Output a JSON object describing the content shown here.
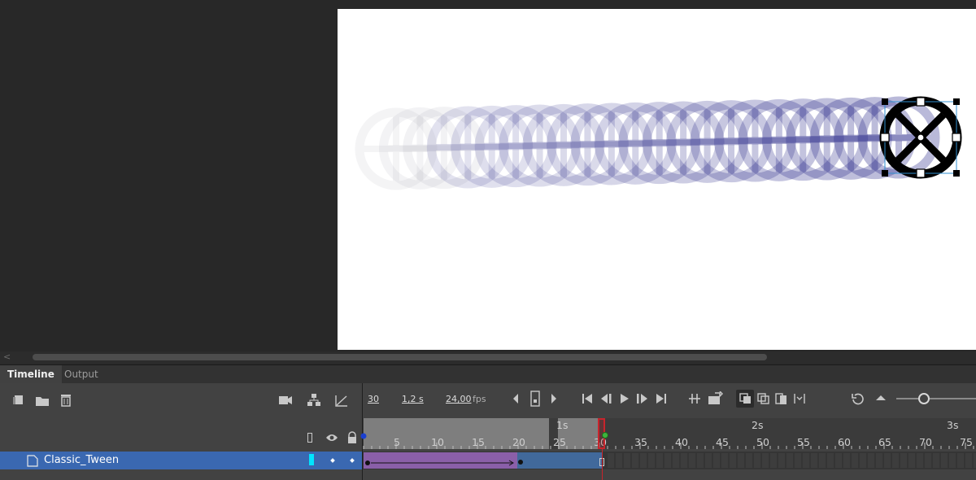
{
  "stage": {
    "background": "#ffffff",
    "symbol_color": "#1a1a80"
  },
  "panel": {
    "tabs": [
      {
        "label": "Timeline"
      },
      {
        "label": "Output"
      }
    ]
  },
  "controls": {
    "current_frame": "30",
    "time": "1,2 s",
    "fps_value": "24,00",
    "fps_unit": "fps"
  },
  "ruler": {
    "frame_numbers": [
      "5",
      "10",
      "15",
      "20",
      "25",
      "30",
      "35",
      "40",
      "45",
      "50",
      "55",
      "60",
      "65",
      "70",
      "75"
    ],
    "seconds": [
      "1s",
      "2s",
      "3s"
    ]
  },
  "layer": {
    "name": "Classic_Tween",
    "color": "#00e5ff"
  },
  "colors": {
    "tween_purple": "#8a5fa8",
    "tween_blue": "#41699b",
    "playhead": "#c8242c",
    "selection": "#3a68b1"
  },
  "icons": {
    "left_toolbar": [
      "new-layer-icon",
      "new-folder-icon",
      "delete-icon"
    ],
    "right_toolbar": [
      "camera-icon",
      "layer-parenting-icon",
      "tween-ease-icon"
    ],
    "playback": [
      "go-first-icon",
      "step-back-icon",
      "play-icon",
      "step-forward-icon",
      "go-last-icon"
    ]
  }
}
